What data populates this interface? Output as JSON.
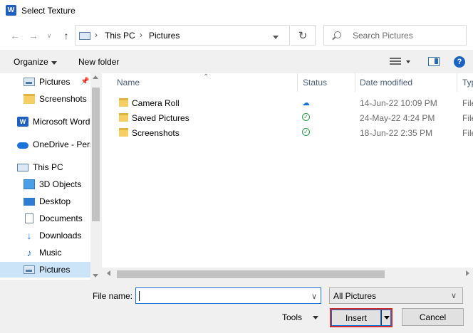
{
  "window": {
    "title": "Select Texture",
    "app_icon": "word-icon",
    "app_icon_letter": "W"
  },
  "nav": {
    "back_icon": "arrow-left-icon",
    "forward_icon": "arrow-right-icon",
    "recent_icon": "chevron-down-icon",
    "up_icon": "arrow-up-icon",
    "address": [
      "This PC",
      "Pictures"
    ],
    "refresh_icon": "refresh-icon",
    "search_placeholder": "Search Pictures"
  },
  "commands": {
    "organize": "Organize",
    "new_folder": "New folder"
  },
  "sidebar": {
    "items": [
      {
        "label": "Pictures",
        "icon": "pictures-icon",
        "pinned": true
      },
      {
        "label": "Screenshots",
        "icon": "folder-icon"
      },
      {
        "label": "Microsoft Word",
        "icon": "word-icon"
      },
      {
        "label": "OneDrive - Pers",
        "icon": "cloud-icon"
      },
      {
        "label": "This PC",
        "icon": "pc-icon"
      },
      {
        "label": "3D Objects",
        "icon": "3d-objects-icon"
      },
      {
        "label": "Desktop",
        "icon": "desktop-icon"
      },
      {
        "label": "Documents",
        "icon": "documents-icon"
      },
      {
        "label": "Downloads",
        "icon": "downloads-icon"
      },
      {
        "label": "Music",
        "icon": "music-icon"
      },
      {
        "label": "Pictures",
        "icon": "pictures-icon",
        "selected": true
      }
    ]
  },
  "files": {
    "columns": [
      "Name",
      "Status",
      "Date modified",
      "Typ"
    ],
    "rows": [
      {
        "name": "Camera Roll",
        "status": "cloud",
        "date": "14-Jun-22 10:09 PM",
        "type": "File"
      },
      {
        "name": "Saved Pictures",
        "status": "synced",
        "date": "24-May-22 4:24 PM",
        "type": "File"
      },
      {
        "name": "Screenshots",
        "status": "synced",
        "date": "18-Jun-22 2:35 PM",
        "type": "File"
      }
    ]
  },
  "footer": {
    "file_name_label": "File name:",
    "file_name_value": "",
    "file_type": "All Pictures",
    "tools": "Tools",
    "insert": "Insert",
    "cancel": "Cancel"
  },
  "colors": {
    "accent": "#0078d7",
    "selection": "#cce4f7",
    "highlight_box": "#d12b2b"
  }
}
